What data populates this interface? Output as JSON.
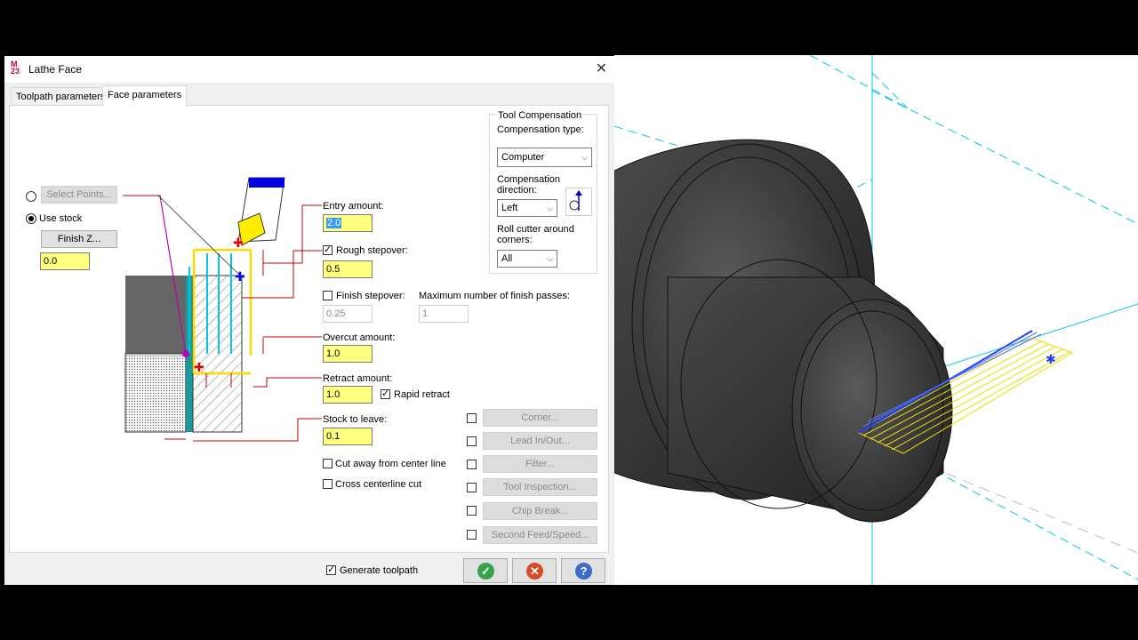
{
  "window": {
    "title": "Lathe Face",
    "icon": "mastercam-icon"
  },
  "tabs": [
    {
      "label": "Toolpath parameters",
      "active": false
    },
    {
      "label": "Face parameters",
      "active": true
    }
  ],
  "left": {
    "select_points": "Select Points...",
    "use_stock": "Use stock",
    "finish_z": "Finish Z...",
    "finish_z_value": "0.0"
  },
  "params": {
    "entry_amount_label": "Entry amount:",
    "entry_amount": "2.0",
    "rough_stepover_label": "Rough stepover:",
    "rough_stepover": "0.5",
    "finish_stepover_label": "Finish stepover:",
    "finish_stepover": "0.25",
    "max_finish_passes_label": "Maximum number of finish passes:",
    "max_finish_passes": "1",
    "overcut_label": "Overcut amount:",
    "overcut": "1.0",
    "retract_label": "Retract amount:",
    "retract": "1.0",
    "rapid_retract": "Rapid retract",
    "stock_to_leave_label": "Stock to leave:",
    "stock_to_leave": "0.1",
    "cut_away": "Cut away from center line",
    "cross_centerline": "Cross centerline cut"
  },
  "tool_comp": {
    "group": "Tool Compensation",
    "type_label": "Compensation type:",
    "type_value": "Computer",
    "direction_label": "Compensation direction:",
    "direction_value": "Left",
    "roll_label": "Roll cutter around corners:",
    "roll_value": "All"
  },
  "buttons": {
    "corner": "Corner...",
    "lead": "Lead In/Out...",
    "filter": "Filter...",
    "tool_inspection": "Tool Inspection...",
    "chip_break": "Chip Break...",
    "second_feed": "Second Feed/Speed..."
  },
  "footer": {
    "generate_toolpath": "Generate toolpath",
    "ok_icon": "✓",
    "cancel_icon": "✕",
    "help_icon": "?"
  },
  "colors": {
    "field_yellow": "#ffff80",
    "leader_red": "#c00000",
    "part_dark": "#3a3a3a",
    "axis_cyan": "#00c8e6"
  }
}
